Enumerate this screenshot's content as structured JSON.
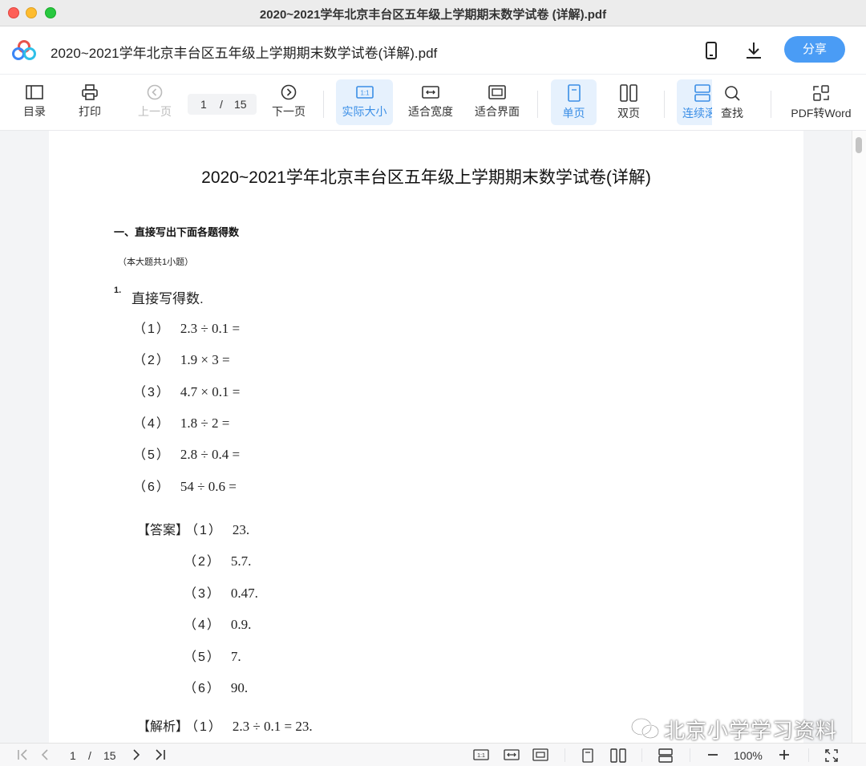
{
  "window": {
    "title": "2020~2021学年北京丰台区五年级上学期期末数学试卷 (详解).pdf"
  },
  "header": {
    "filename": "2020~2021学年北京丰台区五年级上学期期末数学试卷(详解).pdf",
    "share_label": "分享"
  },
  "toolbar": {
    "catalog": "目录",
    "print": "打印",
    "prev": "上一页",
    "page_current": "1",
    "page_sep": "/",
    "page_total": "15",
    "next": "下一页",
    "actual_size": "实际大小",
    "fit_width": "适合宽度",
    "fit_page": "适合界面",
    "single_page": "单页",
    "double_page": "双页",
    "continuous": "连续滚",
    "find": "查找",
    "pdf_to_word": "PDF转Word"
  },
  "document": {
    "title": "2020~2021学年北京丰台区五年级上学期期末数学试卷(详解)",
    "section_title": "一、直接写出下面各题得数",
    "section_note": "（本大题共1小题）",
    "question_number": "1.",
    "question_text": "直接写得数.",
    "items": [
      {
        "idx": "（1）",
        "expr": "2.3 ÷ 0.1 ="
      },
      {
        "idx": "（2）",
        "expr": "1.9 × 3 ="
      },
      {
        "idx": "（3）",
        "expr": "4.7 × 0.1 ="
      },
      {
        "idx": "（4）",
        "expr": "1.8 ÷ 2 ="
      },
      {
        "idx": "（5）",
        "expr": "2.8 ÷ 0.4 ="
      },
      {
        "idx": "（6）",
        "expr": "54 ÷ 0.6 ="
      }
    ],
    "answer_tag": "【答案】",
    "answers": [
      {
        "idx": "（1）",
        "val": "23."
      },
      {
        "idx": "（2）",
        "val": "5.7."
      },
      {
        "idx": "（3）",
        "val": "0.47."
      },
      {
        "idx": "（4）",
        "val": "0.9."
      },
      {
        "idx": "（5）",
        "val": "7."
      },
      {
        "idx": "（6）",
        "val": "90."
      }
    ],
    "analysis_tag": "【解析】",
    "analysis_first": {
      "idx": "（1）",
      "val": "2.3 ÷ 0.1 = 23."
    }
  },
  "bottombar": {
    "page_current": "1",
    "page_sep": "/",
    "page_total": "15",
    "zoom": "100%"
  },
  "watermark": "北京小学学习资料",
  "colors": {
    "accent": "#4a9cf5",
    "active_bg": "#e6f1fd"
  }
}
